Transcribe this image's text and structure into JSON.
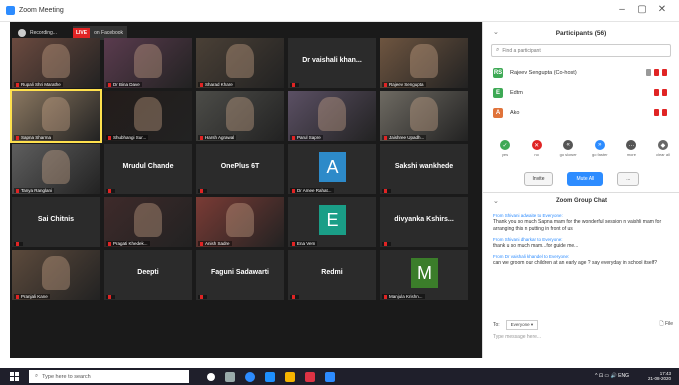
{
  "window": {
    "title": "Zoom Meeting"
  },
  "controls": {
    "minimize": "–",
    "maximize": "▢",
    "close": "✕"
  },
  "video_top": {
    "recording": "Recording...",
    "live_badge": "LIVE",
    "live_text": "on Facebook"
  },
  "tiles": [
    {
      "label": "Rupali Shri Marathe",
      "type": "video",
      "bg": "#6b4a3f"
    },
    {
      "label": "Dr Bina Dave",
      "type": "video",
      "bg": "#5a3b4e"
    },
    {
      "label": "Sharad Khare",
      "type": "video",
      "bg": "#4a4036"
    },
    {
      "name": "Dr vaishali khan...",
      "type": "name"
    },
    {
      "label": "Rajeev Sengupta",
      "type": "video",
      "bg": "#6e5540"
    },
    {
      "label": "Sapna Sharma",
      "type": "video",
      "bg": "#8a7760",
      "active": true
    },
    {
      "label": "Shubhangi Sur...",
      "type": "video",
      "bg": "#231c1a"
    },
    {
      "label": "Harsh Agrawal",
      "type": "video",
      "bg": "#4c4c48"
    },
    {
      "label": "Parul Sapre",
      "type": "video",
      "bg": "#5b5064"
    },
    {
      "label": "Jaishree Upadh...",
      "type": "video",
      "bg": "#6e6a62"
    },
    {
      "label": "Tanya Ranglani",
      "type": "video",
      "bg": "#5e5e5e"
    },
    {
      "name": "Mrudul Chande",
      "type": "name"
    },
    {
      "name": "OnePlus 6T",
      "type": "name"
    },
    {
      "label": "Dr Amee Rahat...",
      "type": "avatar",
      "letter": "A",
      "color": "#2d8ac9"
    },
    {
      "name": "Sakshi wankhede",
      "type": "name"
    },
    {
      "name": "Sai Chitnis",
      "type": "name"
    },
    {
      "label": "Pragati Khedek...",
      "type": "video",
      "bg": "#3e2a2a"
    },
    {
      "label": "Anish Sadre",
      "type": "video",
      "bg": "#7a3b35"
    },
    {
      "label": "Ena Vem",
      "type": "avatar",
      "letter": "E",
      "color": "#1a9e87"
    },
    {
      "name": "divyanka Kshirs...",
      "type": "name"
    },
    {
      "label": "Pranjali Kane",
      "type": "video",
      "bg": "#5c4a3c"
    },
    {
      "name": "Deepti",
      "type": "name"
    },
    {
      "name": "Faguni Sadawarti",
      "type": "name"
    },
    {
      "name": "Redmi",
      "type": "name"
    },
    {
      "label": "Manjula Krishn...",
      "type": "avatar",
      "letter": "M",
      "color": "#3b7d2a"
    }
  ],
  "panel": {
    "title": "Participants (56)",
    "search_placeholder": "Find a participant",
    "participants": [
      {
        "name": "Rajeev Sengupta (Co-host)",
        "initial": "RS",
        "color": "#3ea955"
      },
      {
        "name": "Edtm",
        "initial": "E",
        "color": "#3ea955"
      },
      {
        "name": "Ako",
        "initial": "A",
        "color": "#e0733a"
      }
    ],
    "reactions": [
      {
        "label": "yes",
        "color": "#3ea955",
        "glyph": "✓"
      },
      {
        "label": "no",
        "color": "#e02424",
        "glyph": "✕"
      },
      {
        "label": "go slower",
        "color": "#555555",
        "glyph": "«"
      },
      {
        "label": "go faster",
        "color": "#2d8cff",
        "glyph": "»"
      },
      {
        "label": "more",
        "color": "#555555",
        "glyph": "…"
      },
      {
        "label": "clear all",
        "color": "#666666",
        "glyph": "◆"
      }
    ],
    "buttons": {
      "invite": "Invite",
      "mute_all": "Mute All",
      "more": "..."
    }
  },
  "chat": {
    "title": "Zoom Group Chat",
    "messages": [
      {
        "from": "From Shivani adwaite to Everyone:",
        "text": "Thank you so much Sapna mam for the wonderful session n vaishli mam for arranging this n putting in front of us"
      },
      {
        "from": "From Shivani dharkar to Everyone:",
        "text": "thank u so much mam...for guide me..."
      },
      {
        "from": "From Dr vaishali khandel to Everyone:",
        "text": "can we groom our children at an early age ? say everyday in school itself?"
      }
    ],
    "to_label": "To:",
    "to_value": "Everyone ▾",
    "file_label": "File",
    "type_placeholder": "Type message here..."
  },
  "taskbar": {
    "search_text": "Type here to search",
    "lang": "ENG",
    "time": "17:43",
    "date": "21-08-2020",
    "tray": "^ ⊡ ▭ 🔊"
  }
}
